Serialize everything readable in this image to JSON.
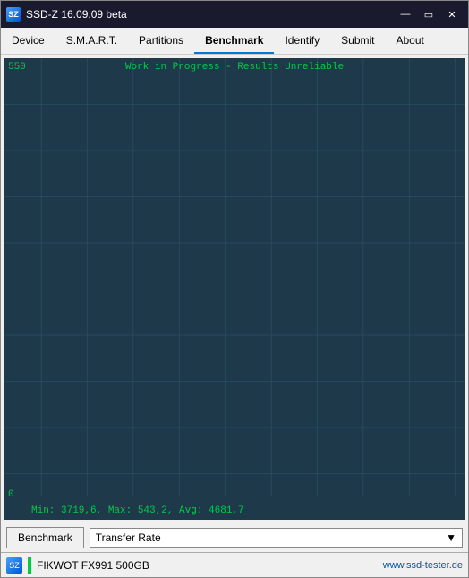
{
  "titlebar": {
    "title": "SSD-Z 16.09.09 beta",
    "icon": "SZ"
  },
  "menu": {
    "items": [
      {
        "label": "Device",
        "active": false
      },
      {
        "label": "S.M.A.R.T.",
        "active": false
      },
      {
        "label": "Partitions",
        "active": false
      },
      {
        "label": "Benchmark",
        "active": true
      },
      {
        "label": "Identify",
        "active": false
      },
      {
        "label": "Submit",
        "active": false
      },
      {
        "label": "About",
        "active": false
      }
    ]
  },
  "chart": {
    "title": "Work in Progress - Results Unreliable",
    "y_top": "550",
    "y_bottom": "0",
    "stats": "Min: 3719,6, Max: 543,2, Avg: 4681,7"
  },
  "toolbar": {
    "benchmark_label": "Benchmark",
    "dropdown_value": "Transfer Rate",
    "dropdown_arrow": "▼"
  },
  "statusbar": {
    "drive_name": "FIKWOT FX991 500GB",
    "website": "www.ssd-tester.de"
  }
}
